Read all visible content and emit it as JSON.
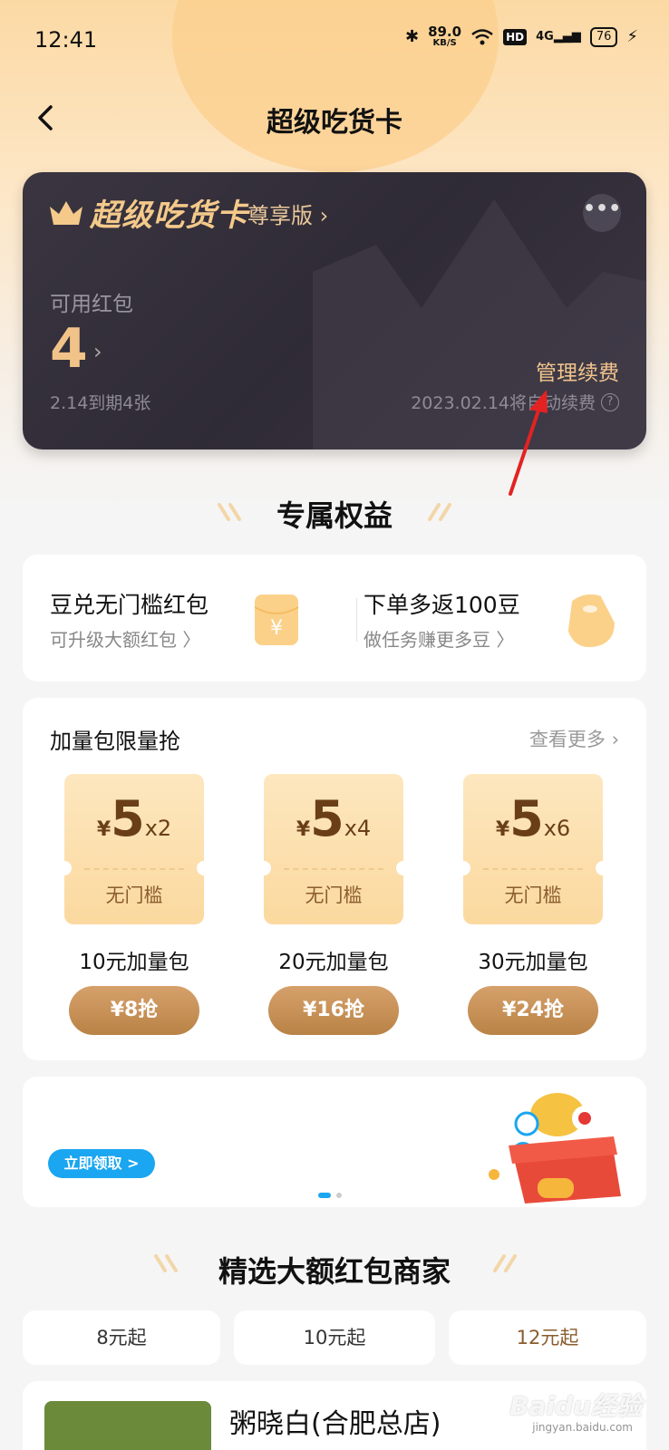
{
  "status": {
    "time": "12:41",
    "speed_value": "89.0",
    "speed_unit": "KB/S",
    "hd": "HD",
    "network": "4G",
    "battery": "76"
  },
  "nav": {
    "title": "超级吃货卡"
  },
  "card": {
    "brand": "超级吃货卡",
    "tier": "尊享版",
    "more": "•••",
    "available_label": "可用红包",
    "count": "4",
    "expire_text": "2.14到期4张",
    "manage_label": "管理续费",
    "renew_text": "2023.02.14将自动续费"
  },
  "benefits": {
    "title": "专属权益",
    "items": [
      {
        "title": "豆兑无门槛红包",
        "sub": "可升级大额红包 〉"
      },
      {
        "title": "下单多返100豆",
        "sub": "做任务赚更多豆 〉"
      }
    ]
  },
  "packs": {
    "title": "加量包限量抢",
    "see_more": "查看更多",
    "items": [
      {
        "yen": "¥",
        "amount": "5",
        "mult": "x2",
        "tag": "无门槛",
        "name": "10元加量包",
        "price": "¥8抢"
      },
      {
        "yen": "¥",
        "amount": "5",
        "mult": "x4",
        "tag": "无门槛",
        "name": "20元加量包",
        "price": "¥16抢"
      },
      {
        "yen": "¥",
        "amount": "5",
        "mult": "x6",
        "tag": "无门槛",
        "name": "30元加量包",
        "price": "¥24抢"
      }
    ]
  },
  "banner": {
    "claim": "立即领取 >"
  },
  "merchants": {
    "title": "精选大额红包商家",
    "chips": [
      "8元起",
      "10元起",
      "12元起"
    ],
    "shop_name": "粥晓白(合肥总店)"
  },
  "watermark": {
    "main": "Baidu经验",
    "sub": "jingyan.baidu.com"
  }
}
